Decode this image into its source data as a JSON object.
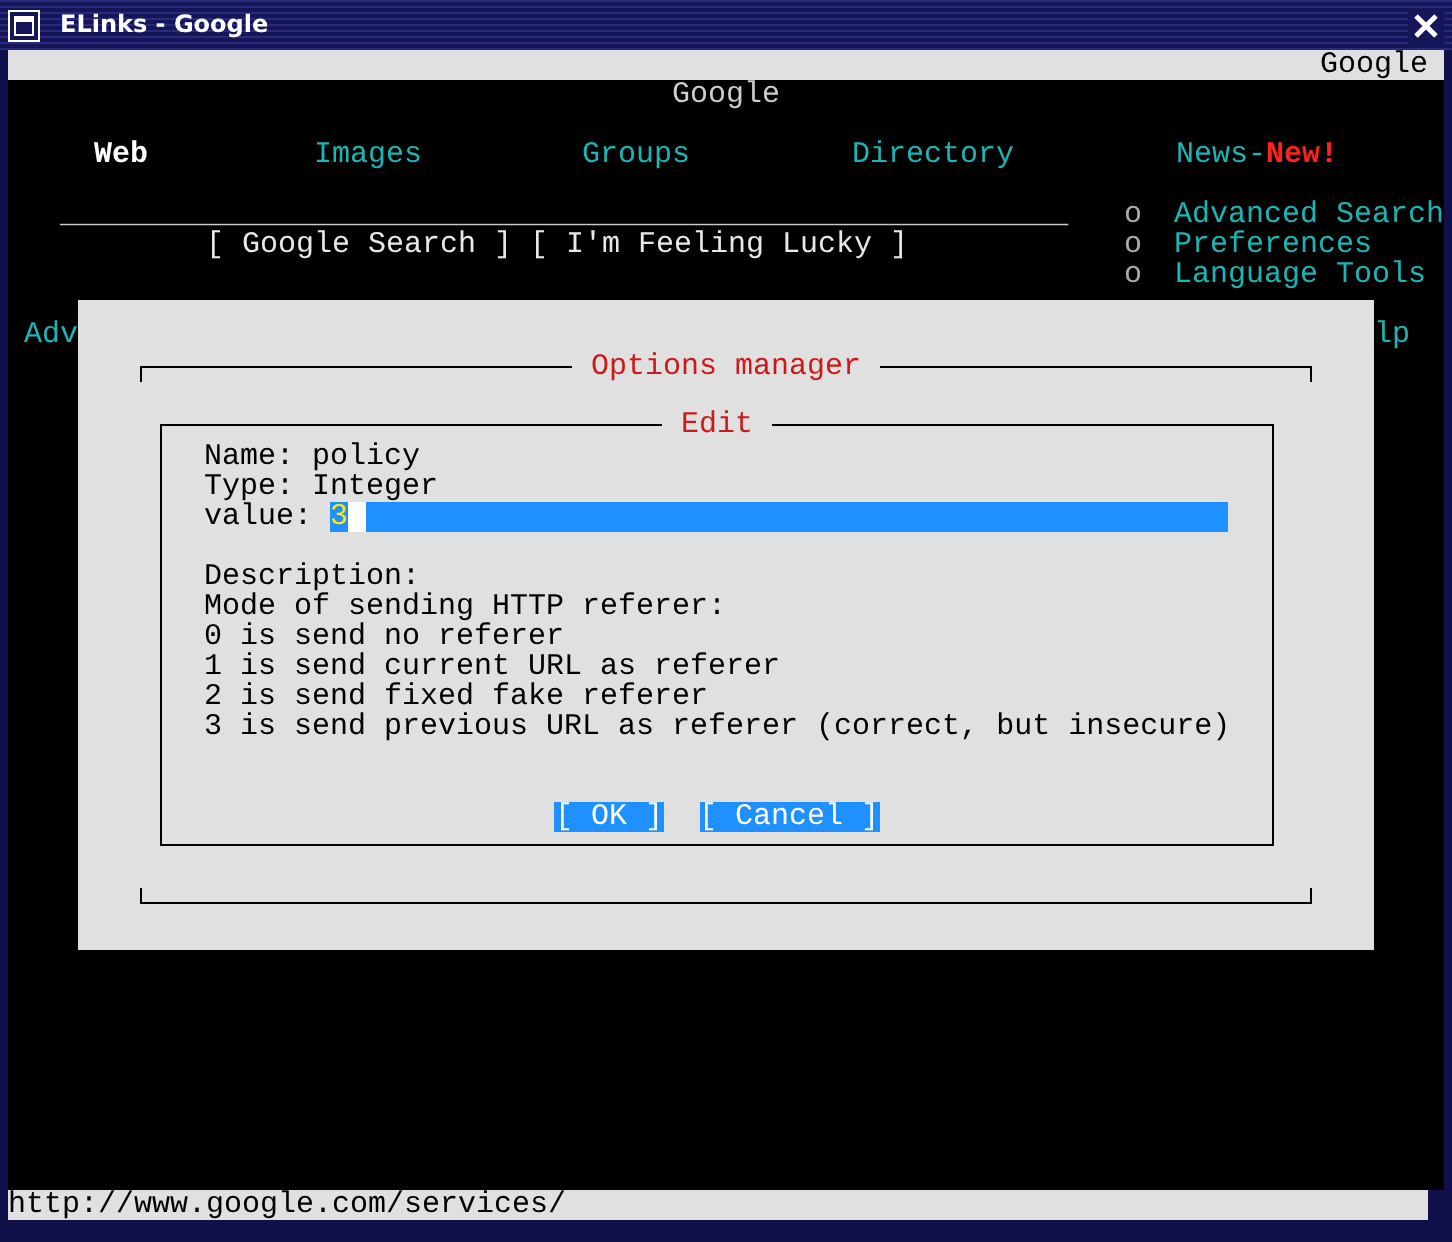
{
  "window": {
    "title": "ELinks - Google"
  },
  "tab_bar": {
    "title": "Google"
  },
  "page": {
    "heading": "Google",
    "nav": [
      {
        "label": "Web",
        "selected": true
      },
      {
        "label": "Images",
        "selected": false
      },
      {
        "label": "Groups",
        "selected": false
      },
      {
        "label": "Directory",
        "selected": false
      },
      {
        "label": "News-",
        "badge": "New!",
        "selected": false
      }
    ],
    "search_field": {
      "value": "________________________________________________________"
    },
    "buttons": [
      "[ Google Search ]",
      "[ I'm Feeling Lucky ]"
    ],
    "side_links": [
      {
        "bullet": "o",
        "label": "Advanced Search"
      },
      {
        "bullet": "o",
        "label": "Preferences"
      },
      {
        "bullet": "o",
        "label": "Language Tools"
      }
    ],
    "partial_left": "Adv",
    "partial_right": "lp"
  },
  "dialog": {
    "title": "Options manager",
    "edit": {
      "title": "Edit",
      "info": [
        "Name: policy",
        "Type: Integer"
      ],
      "value_label": "value:",
      "value": "3",
      "description": [
        "Description:",
        "Mode of sending HTTP referer:",
        "0 is send no referer",
        "1 is send current URL as referer",
        "2 is send fixed fake referer",
        "3 is send previous URL as referer (correct, but insecure)"
      ],
      "buttons": [
        "[ OK ]",
        "[ Cancel ]"
      ]
    }
  },
  "status_bar": {
    "url": "http://www.google.com/services/"
  }
}
